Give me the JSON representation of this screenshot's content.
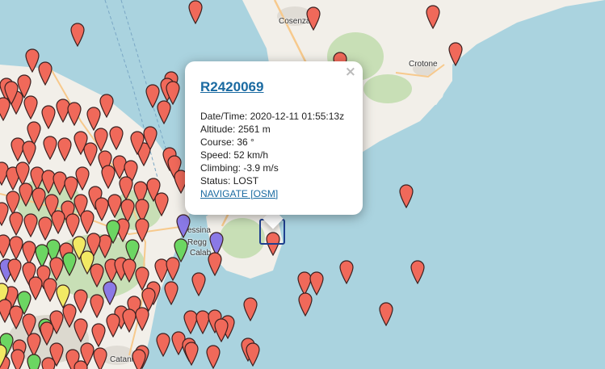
{
  "map": {
    "places": [
      {
        "name": "Cosenza"
      },
      {
        "name": "Crotone"
      },
      {
        "name": "essina"
      },
      {
        "name": "Regg"
      },
      {
        "name": "Calab"
      },
      {
        "name": "Catania"
      }
    ],
    "marker_colors": {
      "red": "#f0695a",
      "green": "#6cd662",
      "yellow": "#f2e964",
      "purple": "#8a79e6",
      "outline": "#3a2020"
    },
    "colors": {
      "sea": "#aad3df",
      "land": "#f2efe9",
      "forest": "#c8dfb6",
      "urban": "#e0dcd5",
      "road": "#f7c98c"
    }
  },
  "popup": {
    "title": "R2420069",
    "close_label": "×",
    "datetime": "Date/Time: 2020-12-11 01:55:13z",
    "altitude": "Altitude: 2561 m",
    "course": "Course: 36 °",
    "speed": "Speed: 52 km/h",
    "climbing": "Climbing: -3.9 m/s",
    "status": "Status: LOST",
    "navigate_link": "NAVIGATE [OSM]"
  }
}
